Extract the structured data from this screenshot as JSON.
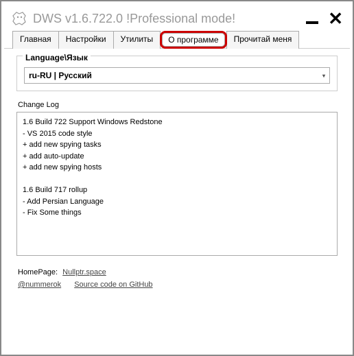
{
  "window": {
    "title": "DWS v1.6.722.0  !Professional mode!"
  },
  "tabs": {
    "main": "Главная",
    "settings": "Настройки",
    "utilities": "Утилиты",
    "about": "О программе",
    "readme": "Прочитай меня"
  },
  "language": {
    "label": "Language\\Язык",
    "value": "ru-RU | Русский"
  },
  "changelog": {
    "label": "Change Log",
    "text": "1.6 Build 722 Support Windows Redstone\n- VS 2015 code style\n+ add new spying tasks\n+ add auto-update\n+ add new spying hosts\n\n1.6 Build 717 rollup\n- Add Persian Language\n- Fix Some things"
  },
  "footer": {
    "homepage_label": "HomePage:",
    "homepage_link": "Nullptr.space",
    "author_link": "@nummerok",
    "source_link": "Source code on GitHub"
  }
}
